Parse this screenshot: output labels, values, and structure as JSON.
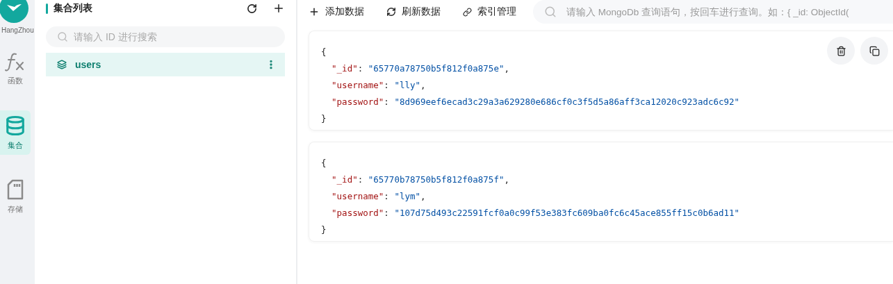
{
  "rail": {
    "workspace": "HangZhou",
    "items": [
      {
        "kind": "function",
        "label": "函数",
        "selected": false
      },
      {
        "kind": "collection",
        "label": "集合",
        "selected": true
      },
      {
        "kind": "storage",
        "label": "存储",
        "selected": false
      }
    ]
  },
  "collections": {
    "title": "集合列表",
    "search": {
      "placeholder": "请输入 ID 进行搜索"
    },
    "items": [
      {
        "name": "users",
        "selected": true
      }
    ]
  },
  "toolbar": {
    "buttons": [
      {
        "kind": "add",
        "label": "添加数据"
      },
      {
        "kind": "refresh",
        "label": "刷新数据"
      },
      {
        "kind": "index",
        "label": "索引管理"
      }
    ],
    "query": {
      "placeholder": "请输入 MongoDb 查询语句，按回车进行查询。如：{ _id: ObjectId("
    }
  },
  "documents": [
    {
      "open": "{",
      "close": "}",
      "fields": [
        {
          "key": "\"_id\"",
          "sep": ": ",
          "value": "\"65770a78750b5f812f0a875e\"",
          "end": ","
        },
        {
          "key": "\"username\"",
          "sep": ": ",
          "value": "\"lly\"",
          "end": ","
        },
        {
          "key": "\"password\"",
          "sep": ": ",
          "value": "\"8d969eef6ecad3c29a3a629280e686cf0c3f5d5a86aff3ca12020c923adc6c92\""
        }
      ],
      "actions": true
    },
    {
      "open": "{",
      "close": "}",
      "fields": [
        {
          "key": "\"_id\"",
          "sep": ": ",
          "value": "\"65770b78750b5f812f0a875f\"",
          "end": ","
        },
        {
          "key": "\"username\"",
          "sep": ": ",
          "value": "\"lym\"",
          "end": ","
        },
        {
          "key": "\"password\"",
          "sep": ": ",
          "value": "\"107d75d493c22591fcf0a0c99f53e383fc609ba0fc6c45ace855ff15c0b6ad11\""
        }
      ],
      "actions": false
    }
  ]
}
